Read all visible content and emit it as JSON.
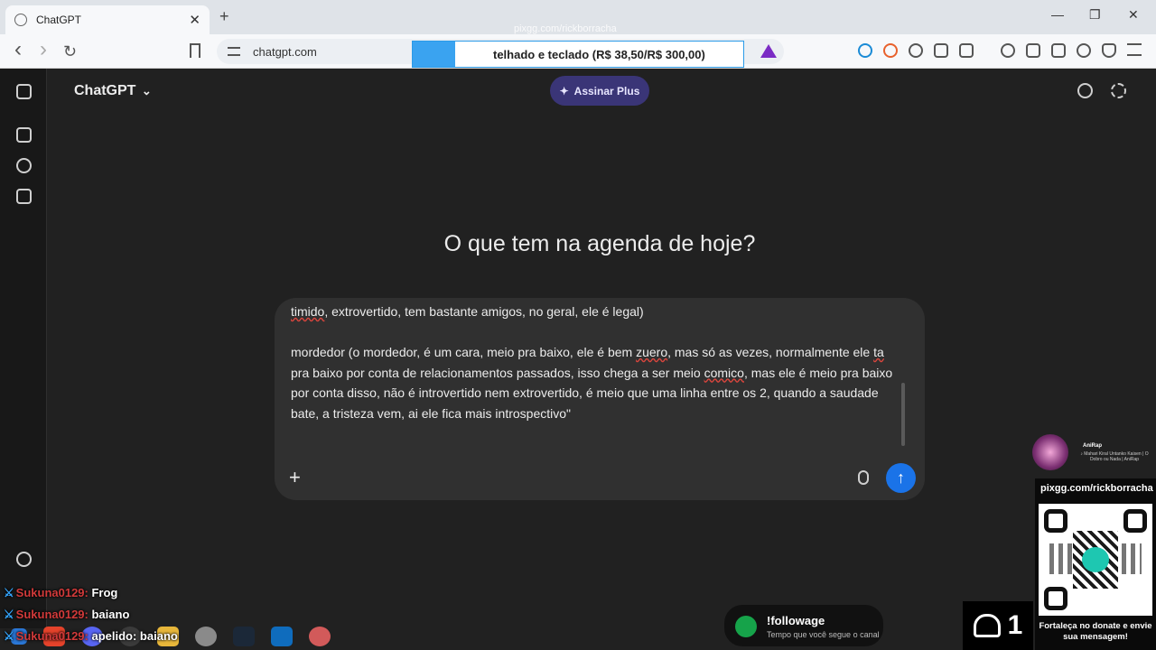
{
  "browser": {
    "tab_title": "ChatGPT",
    "url": "chatgpt.com",
    "new_tab": "+",
    "window_controls": [
      "—",
      "❐",
      "✕"
    ],
    "back": "‹",
    "forward": "›",
    "reload": "↻"
  },
  "overlay": {
    "watermark": "pixgg.com/rickborracha",
    "donation_goal_text": "telhado e teclado (R$ 38,50/R$ 300,00)",
    "donation_progress": 0.128
  },
  "app": {
    "brand": "ChatGPT",
    "brand_chevron": "⌄",
    "upgrade_button": "Assinar Plus",
    "upgrade_icon": "✦",
    "headline": "O que tem na agenda de hoje?"
  },
  "composer": {
    "line1_pre": "timido",
    "line1_post": ", extrovertido, tem bastante amigos, no geral, ele é legal)",
    "para_part1": "mordedor (o mordedor, é um cara, meio pra baixo, ele é bem ",
    "para_word1": "zuero",
    "para_part2": ", mas só as vezes, normalmente ele ",
    "para_word2": "ta",
    "para_part3": " pra baixo por conta de relacionamentos passados, isso chega a ser meio ",
    "para_word3": "comico",
    "para_part4": ", mas ele é meio pra baixo por conta disso, não é introvertido nem extrovertido, é meio que uma linha entre os 2, quando a saudade bate, a tristeza vem, ai ele fica mais introspectivo\"",
    "add_glyph": "+",
    "send_glyph": "↑"
  },
  "chat_messages": [
    {
      "user": "Sukuna0129:",
      "text": "Frog"
    },
    {
      "user": "Sukuna0129:",
      "text": "baiano"
    },
    {
      "user": "Sukuna0129:",
      "text": "apelido: baiano"
    }
  ],
  "followage": {
    "command": "!followage",
    "description": "Tempo que você segue o canal"
  },
  "viewers": {
    "count": "1"
  },
  "now_playing": {
    "title": "AniRap",
    "subtitle": "♪ Mahari Kiral Untanko Kaisen | O Dobro ou Nada | AniRap"
  },
  "qr_panel": {
    "url": "pixgg.com/rickborracha",
    "cta": "Fortaleça no donate e envie sua mensagem!"
  },
  "colors": {
    "accent": "#1a73e8",
    "upgrade_bg": "#3a3577",
    "chat_user": "#d23a3a"
  }
}
